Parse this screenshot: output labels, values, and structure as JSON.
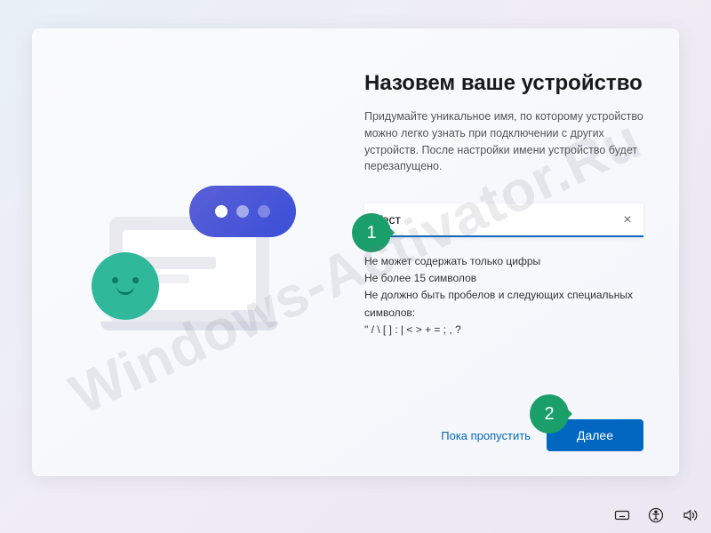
{
  "watermark": "Windows-Activator.Ru",
  "header": {
    "title": "Назовем ваше устройство",
    "subtitle": "Придумайте уникальное имя, по которому устройство можно легко узнать при подключении с других устройств. После настройки имени устройство будет перезапущено."
  },
  "input": {
    "value": "Тест",
    "clear_glyph": "×"
  },
  "rules": {
    "line1": "Не может содержать только цифры",
    "line2": "Не более 15 символов",
    "line3": "Не должно быть пробелов и следующих специальных символов:",
    "line4": "\" / \\ [ ] : | < > + = ; , ?"
  },
  "footer": {
    "skip_label": "Пока пропустить",
    "next_label": "Далее"
  },
  "callouts": {
    "one": "1",
    "two": "2"
  },
  "colors": {
    "accent": "#0067c0",
    "callout_green": "#1a9e6a",
    "teal": "#2fb89a"
  }
}
